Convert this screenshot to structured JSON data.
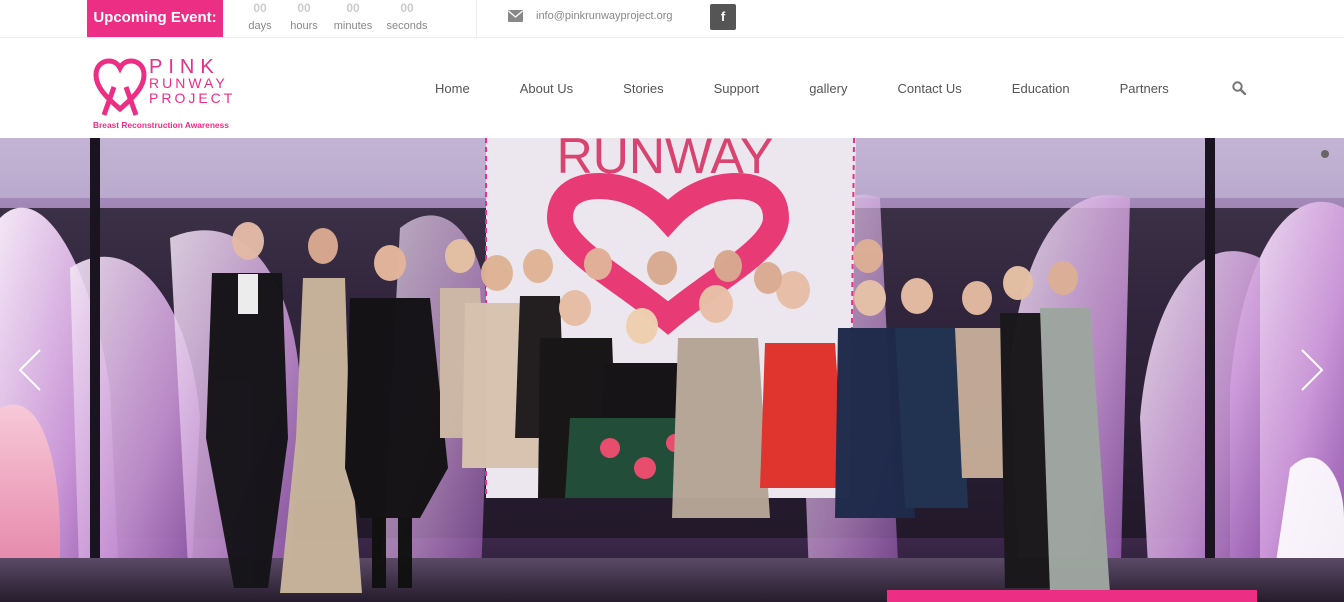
{
  "topbar": {
    "event_label": "Upcoming Event:",
    "countdown": [
      {
        "value": "00",
        "unit": "days"
      },
      {
        "value": "00",
        "unit": "hours"
      },
      {
        "value": "00",
        "unit": "minutes"
      },
      {
        "value": "00",
        "unit": "seconds"
      }
    ],
    "email": "info@pinkrunwayproject.org",
    "facebook_label": "f"
  },
  "logo": {
    "line1": "PINK",
    "line2": "RUNWAY",
    "line3": "PROJECT",
    "tagline": "Breast Reconstruction Awareness"
  },
  "nav": {
    "items": [
      "Home",
      "About Us",
      "Stories",
      "Support",
      "gallery",
      "Contact Us",
      "Education",
      "Partners"
    ]
  },
  "hero": {
    "banner_text": "RUNWAY"
  },
  "colors": {
    "brand_pink": "#ec2e84",
    "nav_text": "#555555",
    "muted": "#888888"
  },
  "icons": [
    "mail-icon",
    "facebook-icon",
    "search-icon",
    "chevron-left-icon",
    "chevron-right-icon",
    "heart-ribbon-logo"
  ]
}
